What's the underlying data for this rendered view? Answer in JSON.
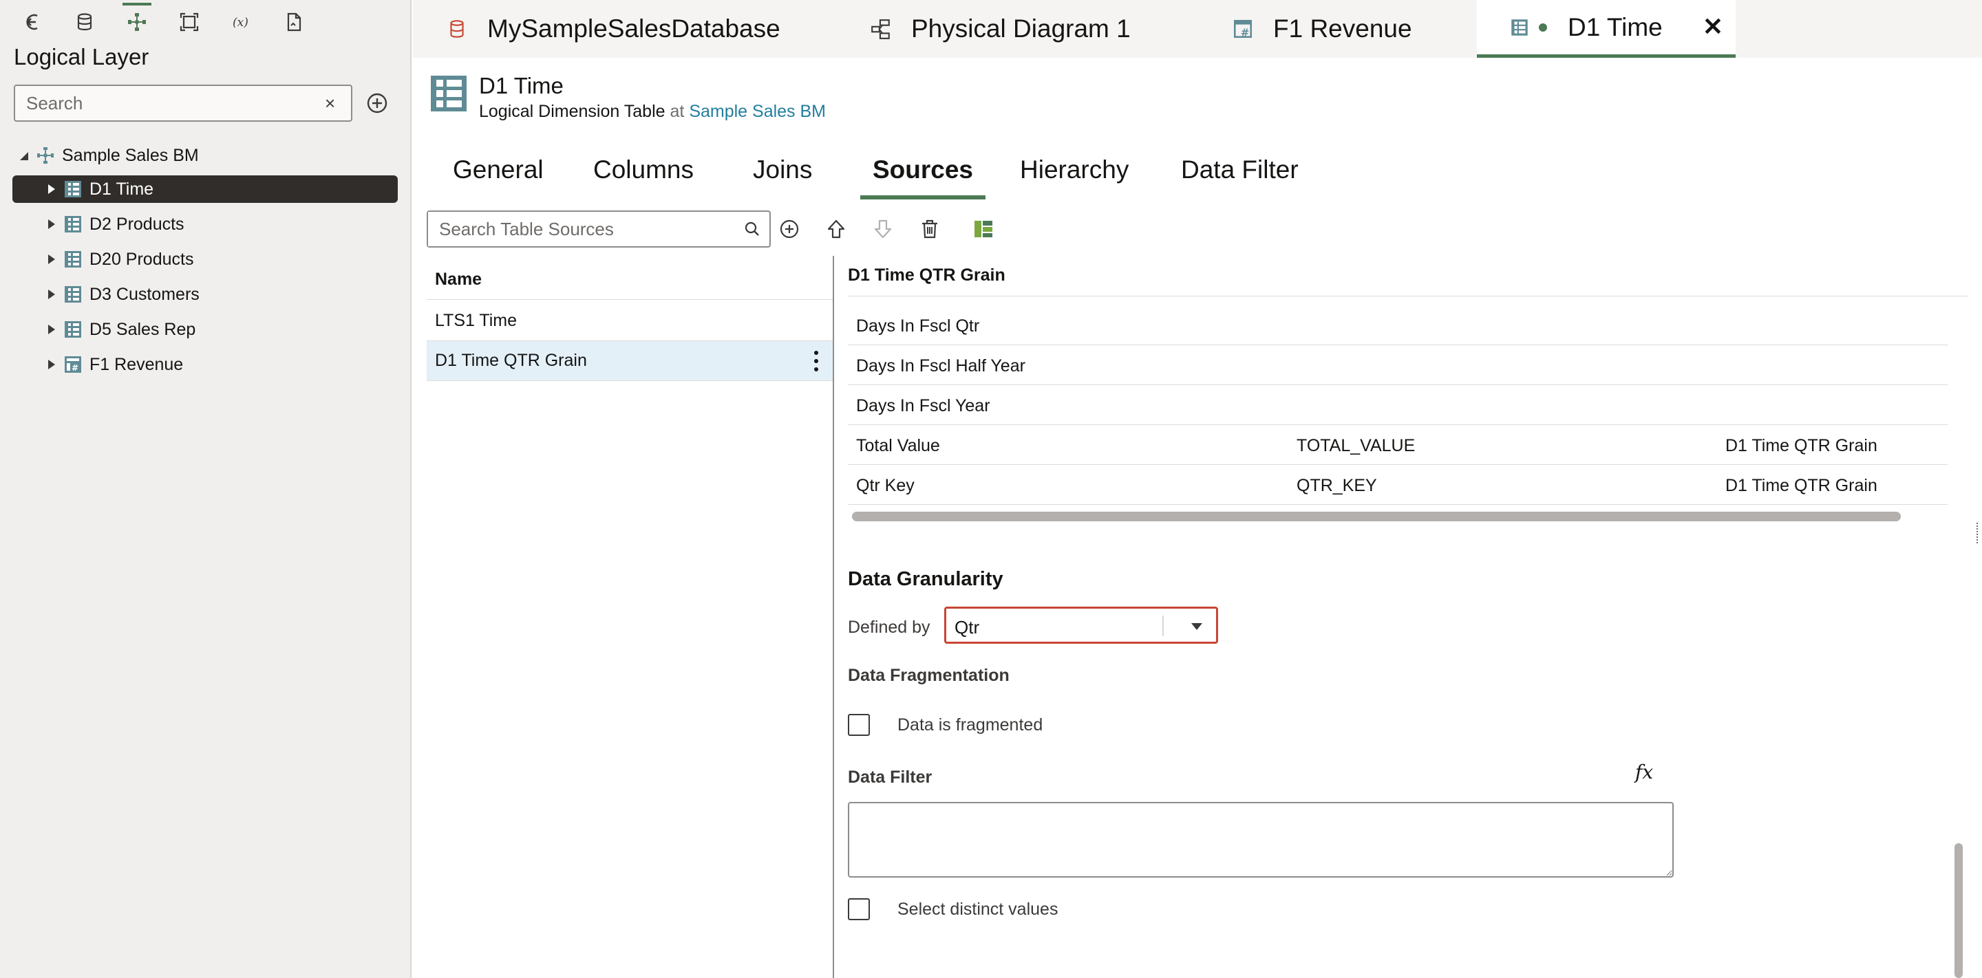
{
  "left_panel": {
    "title": "Logical Layer",
    "search_placeholder": "Search",
    "tree": {
      "root": "Sample Sales BM",
      "items": [
        {
          "label": "D1 Time",
          "type": "dimension",
          "selected": true
        },
        {
          "label": "D2 Products",
          "type": "dimension"
        },
        {
          "label": "D20 Products",
          "type": "dimension"
        },
        {
          "label": "D3 Customers",
          "type": "dimension"
        },
        {
          "label": "D5 Sales Rep",
          "type": "dimension"
        },
        {
          "label": "F1 Revenue",
          "type": "fact"
        }
      ]
    }
  },
  "tabs": [
    {
      "label": "MySampleSalesDatabase",
      "icon": "database-icon"
    },
    {
      "label": "Physical Diagram 1",
      "icon": "diagram-icon"
    },
    {
      "label": "F1 Revenue",
      "icon": "fact-table-icon"
    },
    {
      "label": "D1 Time",
      "icon": "dimension-table-icon",
      "active": true
    }
  ],
  "header": {
    "title": "D1 Time",
    "type": "Logical Dimension Table",
    "at": "at",
    "parent": "Sample Sales BM"
  },
  "subtabs": [
    "General",
    "Columns",
    "Joins",
    "Sources",
    "Hierarchy",
    "Data Filter"
  ],
  "sources": {
    "search_placeholder": "Search Table Sources",
    "column_header": "Name",
    "rows": [
      "LTS1 Time",
      "D1 Time QTR Grain"
    ]
  },
  "mapping": {
    "title": "D1 Time QTR Grain",
    "rows": [
      {
        "logical": "Days In Fscl Qtr",
        "physical": "",
        "table": ""
      },
      {
        "logical": "Days In Fscl Half Year",
        "physical": "",
        "table": ""
      },
      {
        "logical": "Days In Fscl Year",
        "physical": "",
        "table": ""
      },
      {
        "logical": "Total Value",
        "physical": "TOTAL_VALUE",
        "table": "D1 Time QTR Grain"
      },
      {
        "logical": "Qtr Key",
        "physical": "QTR_KEY",
        "table": "D1 Time QTR Grain"
      }
    ]
  },
  "granularity": {
    "title": "Data Granularity",
    "defined_by_label": "Defined by",
    "defined_by_value": "Qtr"
  },
  "fragmentation": {
    "title": "Data Fragmentation",
    "checkbox_label": "Data is fragmented"
  },
  "filter": {
    "title": "Data Filter",
    "fx": "fx",
    "distinct_label": "Select distinct values"
  },
  "colors": {
    "accent": "#4b7a55",
    "link": "#227e9e",
    "error_border": "#c74634",
    "selected_tree": "#312d2a",
    "selected_row": "#e4f0f8"
  }
}
